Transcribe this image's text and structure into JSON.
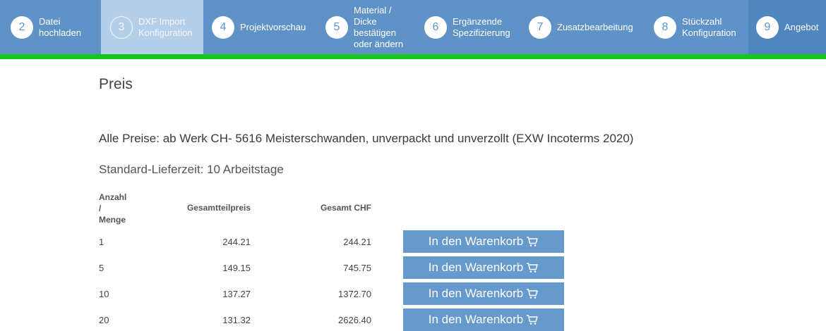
{
  "steps": [
    {
      "number": "2",
      "line1": "Datei",
      "line2": "hochladen",
      "line3": "",
      "line4": ""
    },
    {
      "number": "3",
      "line1": "DXF Import",
      "line2": "Konfiguration",
      "line3": "",
      "line4": ""
    },
    {
      "number": "4",
      "line1": "Projektvorschau",
      "line2": "",
      "line3": "",
      "line4": ""
    },
    {
      "number": "5",
      "line1": "Material /",
      "line2": "Dicke",
      "line3": "bestätigen",
      "line4": "oder ändern"
    },
    {
      "number": "6",
      "line1": "Ergänzende",
      "line2": "Spezifizierung",
      "line3": "",
      "line4": ""
    },
    {
      "number": "7",
      "line1": "Zusatzbearbeitung",
      "line2": "",
      "line3": "",
      "line4": ""
    },
    {
      "number": "8",
      "line1": "Stückzahl",
      "line2": "Konfiguration",
      "line3": "",
      "line4": ""
    },
    {
      "number": "9",
      "line1": "Angebot",
      "line2": "",
      "line3": "",
      "line4": ""
    }
  ],
  "page": {
    "title": "Preis",
    "subtitle": "Alle Preise: ab Werk CH- 5616 Meisterschwanden, unverpackt und unverzollt (EXW Incoterms 2020)",
    "leadtime": "Standard-Lieferzeit: 10 Arbeitstage"
  },
  "table": {
    "header_qty_1": "Anzahl",
    "header_qty_2": "/",
    "header_qty_3": "Menge",
    "header_unit": "Gesamtteilpreis",
    "header_total": "Gesamt CHF",
    "cart_label": "In den Warenkorb",
    "rows": [
      {
        "qty": "1",
        "unit": "244.21",
        "total": "244.21"
      },
      {
        "qty": "5",
        "unit": "149.15",
        "total": "745.75"
      },
      {
        "qty": "10",
        "unit": "137.27",
        "total": "1372.70"
      },
      {
        "qty": "20",
        "unit": "131.32",
        "total": "2626.40"
      }
    ]
  },
  "colors": {
    "step_bar": "#5f93c7",
    "step_active": "#b5cfe8",
    "progress_green": "#16c618",
    "cart_button": "#6699cc"
  },
  "icons": {
    "cart": "shopping-cart-icon"
  }
}
